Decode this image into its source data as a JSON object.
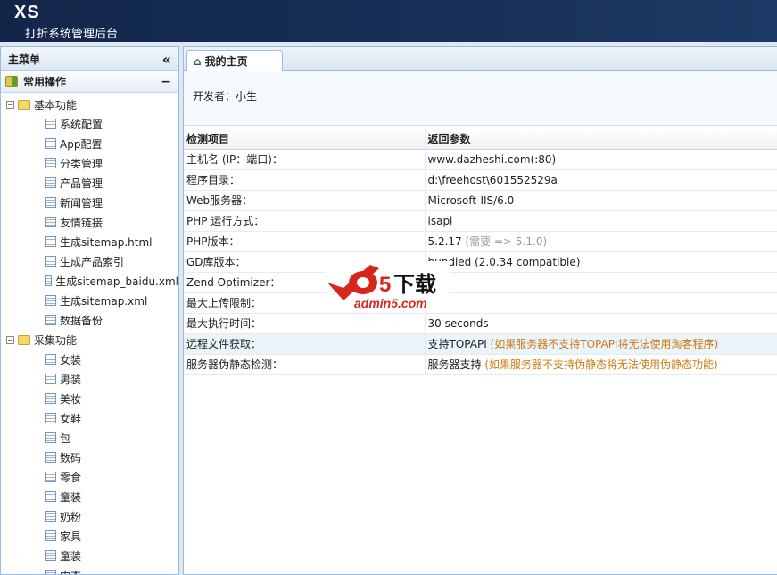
{
  "header": {
    "logo": "XS",
    "subtitle": "打折系统管理后台"
  },
  "sidebar": {
    "title": "主菜单",
    "collapse_icon": "«",
    "section": "常用操作",
    "section_toggle": "−",
    "groups": [
      {
        "label": "基本功能",
        "items": [
          "系统配置",
          "App配置",
          "分类管理",
          "产品管理",
          "新闻管理",
          "友情链接",
          "生成sitemap.html",
          "生成产品索引",
          "生成sitemap_baidu.xml",
          "生成sitemap.xml",
          "数据备份"
        ]
      },
      {
        "label": "采集功能",
        "items": [
          "女装",
          "男装",
          "美妆",
          "女鞋",
          "包",
          "数码",
          "零食",
          "童装",
          "奶粉",
          "家具",
          "童装",
          "内衣"
        ]
      }
    ]
  },
  "main": {
    "tab": "我的主页",
    "developer": "开发者：小生",
    "table": {
      "headers": [
        "检测项目",
        "返回参数"
      ],
      "rows": [
        {
          "k": "主机名 (IP：端口)：",
          "v": "www.dazheshi.com(:80)",
          "n": ""
        },
        {
          "k": "程序目录：",
          "v": "d:\\freehost\\601552529a",
          "n": ""
        },
        {
          "k": "Web服务器：",
          "v": "Microsoft-IIS/6.0",
          "n": ""
        },
        {
          "k": "PHP 运行方式：",
          "v": "isapi",
          "n": ""
        },
        {
          "k": "PHP版本：",
          "v": "5.2.17",
          "n": "(需要 => 5.1.0)"
        },
        {
          "k": "GD库版本：",
          "v": "bundled (2.0.34 compatible)",
          "n": ""
        },
        {
          "k": "Zend Optimizer：",
          "v": "",
          "n": ""
        },
        {
          "k": "最大上传限制：",
          "v": "",
          "n": ""
        },
        {
          "k": "最大执行时间：",
          "v": "30 seconds",
          "n": ""
        },
        {
          "k": "远程文件获取：",
          "v": "支持TOPAPI",
          "n": "(如果服务器不支持TOPAPI将无法使用淘客程序)"
        },
        {
          "k": "服务器伪静态检测：",
          "v": "服务器支持",
          "n": "(如果服务器不支持伪静态将无法使用伪静态功能)"
        }
      ]
    }
  },
  "watermark": {
    "brand": "a5下载",
    "url": "admin5.com"
  }
}
